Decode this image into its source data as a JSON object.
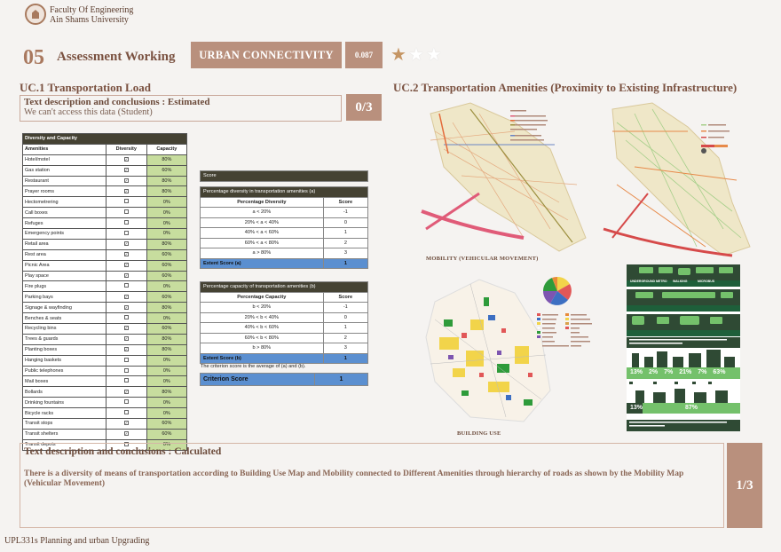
{
  "header": {
    "faculty": "Faculty Of Engineering",
    "university": "Ain Shams University",
    "section_number": "05",
    "section_title": "Assessment Working",
    "tag": "URBAN CONNECTIVITY",
    "score": "0.087",
    "rating": {
      "value": 1,
      "max": 3
    },
    "colors": {
      "accent": "#b9907d",
      "star": "#c59563"
    }
  },
  "uc1": {
    "title": "UC.1 Transportation Load",
    "desc_title": "Text description and conclusions  : Estimated",
    "desc_text": "We can't access this data (Student)",
    "fraction": "0/3"
  },
  "uc2": {
    "title": "UC.2 Transportation Amenities (Proximity to Existing Infrastructure)",
    "caption_mobility": "MOBILITY (VEHICULAR MOVEMENT)",
    "caption_building": "BUILDING USE"
  },
  "diversity_table": {
    "title": "Diversity and Capacity",
    "headers": [
      "Amenities",
      "Diversity",
      "Capacity"
    ],
    "rows": [
      {
        "name": "Hotel/motel",
        "checked": true,
        "capacity": "80%"
      },
      {
        "name": "Gas station",
        "checked": true,
        "capacity": "60%"
      },
      {
        "name": "Restaurant",
        "checked": true,
        "capacity": "80%"
      },
      {
        "name": "Prayer rooms",
        "checked": true,
        "capacity": "80%"
      },
      {
        "name": "Hectometrering",
        "checked": false,
        "capacity": "0%"
      },
      {
        "name": "Call boxes",
        "checked": false,
        "capacity": "0%"
      },
      {
        "name": "Refuges",
        "checked": false,
        "capacity": "0%"
      },
      {
        "name": "Emergency points",
        "checked": false,
        "capacity": "0%"
      },
      {
        "name": "Retail area",
        "checked": true,
        "capacity": "80%"
      },
      {
        "name": "Rest area",
        "checked": true,
        "capacity": "60%"
      },
      {
        "name": "Picnic Area",
        "checked": true,
        "capacity": "60%"
      },
      {
        "name": "Play space",
        "checked": true,
        "capacity": "60%"
      },
      {
        "name": "Fire plugs",
        "checked": false,
        "capacity": "0%"
      },
      {
        "name": "Parking bays",
        "checked": true,
        "capacity": "60%"
      },
      {
        "name": "Signage & wayfinding",
        "checked": true,
        "capacity": "80%"
      },
      {
        "name": "Benches & seats",
        "checked": false,
        "capacity": "0%"
      },
      {
        "name": "Recycling bins",
        "checked": true,
        "capacity": "60%"
      },
      {
        "name": "Trees & guards",
        "checked": true,
        "capacity": "80%"
      },
      {
        "name": "Planting boxes",
        "checked": true,
        "capacity": "80%"
      },
      {
        "name": "Hanging baskets",
        "checked": false,
        "capacity": "0%"
      },
      {
        "name": "Public telephones",
        "checked": false,
        "capacity": "0%"
      },
      {
        "name": "Mail boxes",
        "checked": false,
        "capacity": "0%"
      },
      {
        "name": "Bollards",
        "checked": true,
        "capacity": "80%"
      },
      {
        "name": "Drinking fountains",
        "checked": false,
        "capacity": "0%"
      },
      {
        "name": "Bicycle racks",
        "checked": false,
        "capacity": "0%"
      },
      {
        "name": "Transit stops",
        "checked": true,
        "capacity": "60%"
      },
      {
        "name": "Transit shelters",
        "checked": true,
        "capacity": "60%"
      },
      {
        "name": "Transit depots",
        "checked": false,
        "capacity": "0%"
      }
    ]
  },
  "score_table": {
    "label": "Score",
    "a": {
      "title": "Percentage diversity in transportation amenities (a)",
      "col1": "Percentage Diversity",
      "col2": "Score",
      "rows": [
        [
          "a < 20%",
          "-1"
        ],
        [
          "20% < a < 40%",
          "0"
        ],
        [
          "40% < a < 60%",
          "1"
        ],
        [
          "60% < a < 80%",
          "2"
        ],
        [
          "a > 80%",
          "3"
        ]
      ],
      "extent_label": "Extent Score (a)",
      "extent_value": "1"
    },
    "b": {
      "title": "Percentage capacity of transportation amenities (b)",
      "col1": "Percentage Capacity",
      "col2": "Score",
      "rows": [
        [
          "b < 20%",
          "-1"
        ],
        [
          "20% < b < 40%",
          "0"
        ],
        [
          "40% < b < 60%",
          "1"
        ],
        [
          "60% < b < 80%",
          "2"
        ],
        [
          "b > 80%",
          "3"
        ]
      ],
      "extent_label": "Extent Score (b)",
      "extent_value": "1"
    },
    "note": "The criterion score is the average of (a) and (b).",
    "criterion_label": "Criterion Score",
    "criterion_value": "1"
  },
  "transport_panel": {
    "labels": {
      "underground_metro": "UNDERGROUND METRO",
      "walking": "WALKING",
      "microbus": "MICROBUS",
      "percentages": [
        "13%",
        "2%",
        "7%",
        "21%",
        "7%",
        "63%"
      ],
      "bottom_pct": [
        "13%",
        "87%"
      ]
    }
  },
  "bottom": {
    "title": "Text description and conclusions  :  Calculated",
    "text": "There is a diversity of means of transportation according to Building Use Map and Mobility connected to Different Amenities through hierarchy of roads as shown by the Mobility Map (Vehicular Movement)",
    "fraction": "1/3"
  },
  "footer": "UPL331s Planning and urban Upgrading"
}
